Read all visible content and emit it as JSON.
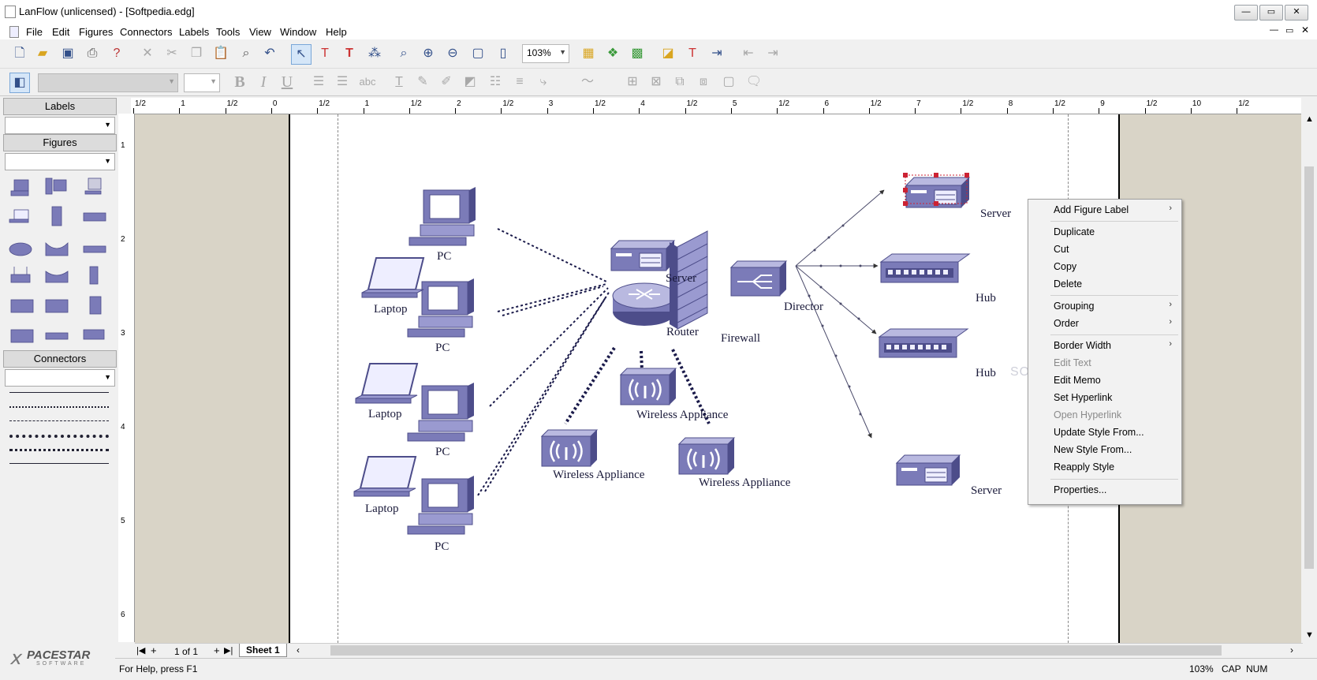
{
  "window": {
    "title": "LanFlow (unlicensed) - [Softpedia.edg]",
    "min_glyph": "—",
    "max_glyph": "▭",
    "close_glyph": "✕"
  },
  "menu": [
    "File",
    "Edit",
    "Figures",
    "Connectors",
    "Labels",
    "Tools",
    "View",
    "Window",
    "Help"
  ],
  "toolbar": {
    "zoom": "103%",
    "style_combo": "",
    "font_size_combo": "",
    "bold": "B",
    "italic": "I",
    "underline": "U",
    "spell": "abc"
  },
  "left_panel": {
    "labels_header": "Labels",
    "labels_value": "",
    "figures_header": "Figures",
    "figures_value": "",
    "connectors_header": "Connectors",
    "connectors_value": "",
    "logo": "PACESTAR",
    "logo_sub": "SOFTWARE"
  },
  "ruler": {
    "h_labels": [
      "1/2",
      "1",
      "1/2",
      "0",
      "1/2",
      "1",
      "1/2",
      "2",
      "1/2",
      "3",
      "1/2",
      "4",
      "1/2",
      "5",
      "1/2",
      "6",
      "1/2",
      "7",
      "1/2",
      "8",
      "1/2",
      "9",
      "1/2",
      "10",
      "1/2"
    ],
    "v_labels": [
      "1",
      "2",
      "3",
      "4",
      "5",
      "6"
    ]
  },
  "diagram": {
    "pc_label": "PC",
    "laptop_label": "Laptop",
    "server_label": "Server",
    "router_label": "Router",
    "firewall_label": "Firewall",
    "director_label": "Director",
    "hub_label": "Hub",
    "wireless_label": "Wireless Appliance",
    "watermark": "SOFTPEDIA"
  },
  "sheet_nav": {
    "page_text": "1 of 1",
    "sheet_tab": "Sheet 1"
  },
  "status": {
    "help": "For Help, press F1",
    "zoom": "103%",
    "cap": "CAP",
    "num": "NUM"
  },
  "context_menu": {
    "items": [
      {
        "label": "Add Figure Label",
        "submenu": true,
        "disabled": false
      },
      {
        "label": "Duplicate",
        "submenu": false,
        "disabled": false
      },
      {
        "label": "Cut",
        "submenu": false,
        "disabled": false
      },
      {
        "label": "Copy",
        "submenu": false,
        "disabled": false
      },
      {
        "label": "Delete",
        "submenu": false,
        "disabled": false
      },
      {
        "label": "Grouping",
        "submenu": true,
        "disabled": false
      },
      {
        "label": "Order",
        "submenu": true,
        "disabled": false
      },
      {
        "label": "Border Width",
        "submenu": true,
        "disabled": false
      },
      {
        "label": "Edit Text",
        "submenu": false,
        "disabled": true
      },
      {
        "label": "Edit Memo",
        "submenu": false,
        "disabled": false
      },
      {
        "label": "Set Hyperlink",
        "submenu": false,
        "disabled": false
      },
      {
        "label": "Open Hyperlink",
        "submenu": false,
        "disabled": true
      },
      {
        "label": "Update Style From...",
        "submenu": false,
        "disabled": false
      },
      {
        "label": "New Style From...",
        "submenu": false,
        "disabled": false
      },
      {
        "label": "Reapply Style",
        "submenu": false,
        "disabled": false
      },
      {
        "label": "Properties...",
        "submenu": false,
        "disabled": false
      }
    ],
    "submenu_arrow": "›"
  },
  "colors": {
    "device_fill": "#7b7bb8",
    "device_dark": "#4d4d8a",
    "device_light": "#b9b9e0",
    "selection": "#cc2233"
  }
}
